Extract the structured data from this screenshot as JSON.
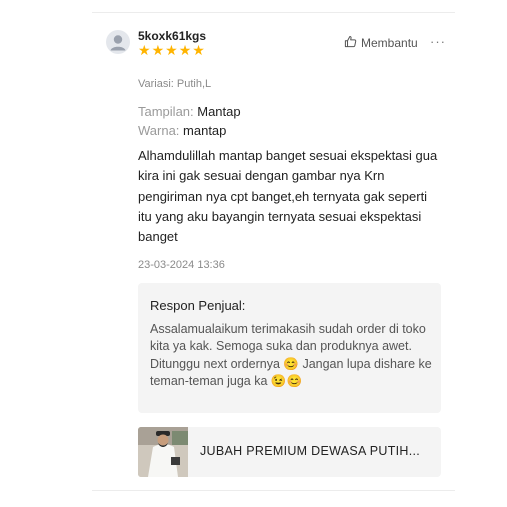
{
  "review": {
    "username": "5koxk61kgs",
    "rating": 5,
    "stars": [
      "★",
      "★",
      "★",
      "★",
      "★"
    ],
    "helpful_label": "Membantu",
    "more_label": "···",
    "variant_text": "Variasi: Putih,L",
    "attributes": [
      {
        "key": "Tampilan: ",
        "value": "Mantap"
      },
      {
        "key": "Warna: ",
        "value": "mantap"
      }
    ],
    "body": "Alhamdulillah mantap banget sesuai ekspektasi gua kira ini gak sesuai dengan gambar nya Krn pengiriman nya cpt banget,eh ternyata gak seperti itu yang aku bayangin ternyata sesuai ekspektasi banget",
    "date": "23-03-2024 13:36",
    "seller_reply": {
      "title": "Respon Penjual:",
      "text": "Assalamualaikum terimakasih sudah order di toko kita ya kak. Semoga suka dan produknya awet. Ditunggu next ordernya 😊 Jangan lupa dishare ke teman-teman juga ka 😉😊"
    },
    "product": {
      "name": "JUBAH PREMIUM DEWASA PUTIH..."
    }
  },
  "colors": {
    "star": "#ffb400",
    "reply_background": "#f4f4f4",
    "muted_text": "#8a8a8a"
  },
  "icons": {
    "avatar": "user-avatar-icon",
    "helpful": "thumbs-up-icon",
    "more": "more-options-icon"
  }
}
